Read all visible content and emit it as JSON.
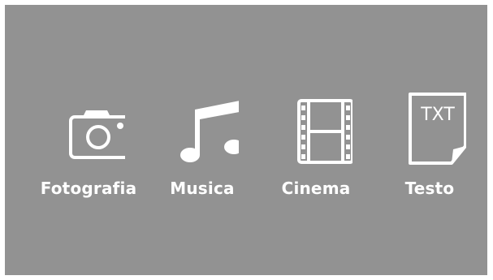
{
  "menu": {
    "items": [
      {
        "label": "Fotografia",
        "icon": "camera-icon"
      },
      {
        "label": "Musica",
        "icon": "music-note-icon"
      },
      {
        "label": "Cinema",
        "icon": "film-strip-icon"
      },
      {
        "label": "Testo",
        "icon": "text-document-icon",
        "icon_text": "TXT"
      }
    ]
  },
  "colors": {
    "background": "#929292",
    "foreground": "#ffffff"
  }
}
